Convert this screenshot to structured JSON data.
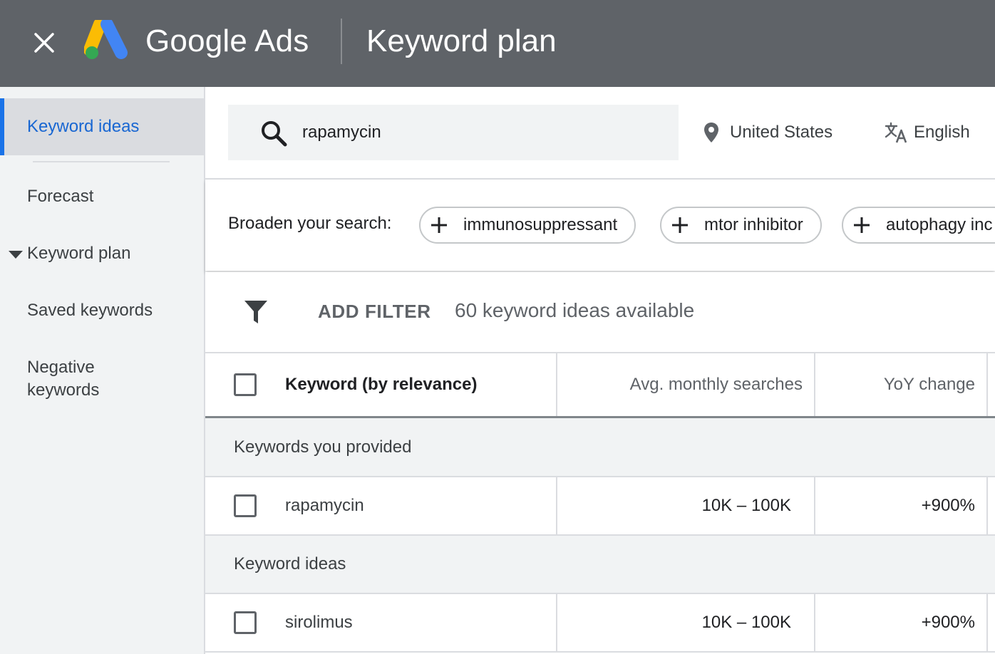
{
  "header": {
    "brand": "Google Ads",
    "title": "Keyword plan"
  },
  "sidebar": {
    "items": [
      {
        "label": "Keyword ideas",
        "active": true
      },
      {
        "label": "Forecast"
      },
      {
        "label": "Keyword plan",
        "expandable": true
      },
      {
        "label": "Saved keywords"
      },
      {
        "label": "Negative keywords"
      }
    ],
    "negative_line1": "Negative",
    "negative_line2": "keywords"
  },
  "search": {
    "value": "rapamycin",
    "location": "United States",
    "language": "English"
  },
  "broaden": {
    "label": "Broaden your search:",
    "chips": [
      "immunosuppressant",
      "mtor inhibitor",
      "autophagy inc"
    ]
  },
  "filter": {
    "add_label": "ADD FILTER",
    "count_text": "60 keyword ideas available"
  },
  "table": {
    "columns": [
      "Keyword (by relevance)",
      "Avg. monthly searches",
      "YoY change"
    ],
    "groups": [
      {
        "label": "Keywords you provided",
        "rows": [
          {
            "keyword": "rapamycin",
            "avg": "10K – 100K",
            "yoy": "+900%"
          }
        ]
      },
      {
        "label": "Keyword ideas",
        "rows": [
          {
            "keyword": "sirolimus",
            "avg": "10K – 100K",
            "yoy": "+900%"
          }
        ]
      }
    ]
  },
  "colors": {
    "topbar": "#5f6368",
    "accent": "#1a73e8",
    "sidebar_bg": "#f1f3f4"
  }
}
